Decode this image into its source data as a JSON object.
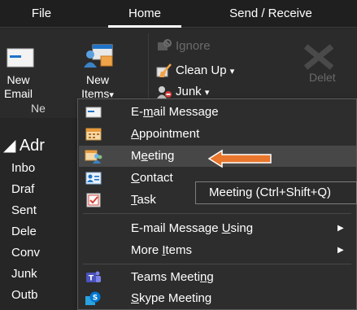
{
  "tabs": [
    {
      "label": "File"
    },
    {
      "label": "Home"
    },
    {
      "label": "Send / Receive"
    }
  ],
  "ribbon": {
    "new_email": {
      "line1": "New",
      "line2": "Email"
    },
    "new_items": {
      "line1": "New",
      "line2": "Items"
    },
    "group_label": "Ne",
    "ignore_label": "Ignore",
    "cleanup_label": "Clean Up",
    "junk_label": "Junk",
    "delete_label": "Delet",
    "dropdown_glyph": "▾"
  },
  "folders": {
    "account": "◢ Adr",
    "items": [
      "Inbo",
      "Draf",
      "Sent",
      "Dele",
      "Conv",
      "Junk",
      "Outb"
    ]
  },
  "menu": {
    "items": [
      {
        "pre": "E-",
        "u": "m",
        "post": "ail Message",
        "icon": "email-message-icon",
        "submenu": false
      },
      {
        "pre": "",
        "u": "A",
        "post": "ppointment",
        "icon": "appointment-icon",
        "submenu": false
      },
      {
        "pre": "M",
        "u": "e",
        "post": "eting",
        "icon": "meeting-icon",
        "submenu": false,
        "hover": true
      },
      {
        "pre": "",
        "u": "C",
        "post": "ontact",
        "icon": "contact-icon",
        "submenu": false
      },
      {
        "pre": "",
        "u": "T",
        "post": "ask",
        "icon": "task-icon",
        "submenu": false
      },
      {
        "pre": "E-mail Message ",
        "u": "U",
        "post": "sing",
        "icon": "",
        "submenu": true
      },
      {
        "pre": "More ",
        "u": "I",
        "post": "tems",
        "icon": "",
        "submenu": true
      },
      {
        "pre": "Teams Meeti",
        "u": "n",
        "post": "g",
        "icon": "teams-icon",
        "submenu": false
      },
      {
        "pre": "",
        "u": "S",
        "post": "kype Meeting",
        "icon": "skype-icon",
        "submenu": false
      }
    ],
    "submenu_arrow": "▶"
  },
  "tooltip": "Meeting (Ctrl+Shift+Q)",
  "colors": {
    "accent_orange": "#e8762c",
    "menu_hover": "#474747",
    "background": "#262626"
  }
}
